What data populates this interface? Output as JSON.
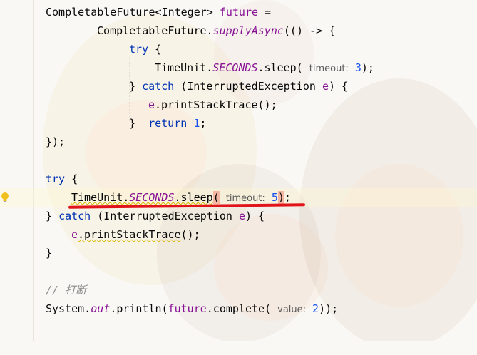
{
  "editor": {
    "lines": {
      "l1": {
        "a": "CompletableFuture",
        "b": "<Integer> ",
        "c": "future",
        "d": " ="
      },
      "l2": {
        "a": "CompletableFuture.",
        "b": "supplyAsync",
        "c": "(() -> {"
      },
      "l3": {
        "a": "try",
        "b": " {"
      },
      "l4": {
        "a": "TimeUnit.",
        "b": "SECONDS",
        "c": ".sleep(",
        "hint": "timeout:",
        "d": "3",
        "e": ");"
      },
      "l5": {
        "a": "} ",
        "b": "catch",
        "c": " (InterruptedException ",
        "d": "e",
        "e": ") {"
      },
      "l6": {
        "a": "e",
        "b": ".printStackTrace();"
      },
      "l7": {
        "a": "}  ",
        "b": "return",
        "c": " ",
        "d": "1",
        "e": ";"
      },
      "l8": {
        "a": "});"
      },
      "l10": {
        "a": "try",
        "b": " {"
      },
      "l11": {
        "a": "TimeUnit.",
        "b": "SECONDS",
        "c": ".sleep",
        "d": "(",
        "hint": "timeout:",
        "e": "5",
        "f": ")",
        "g": ";"
      },
      "l12": {
        "a": "} ",
        "b": "catch",
        "c": " (InterruptedException ",
        "d": "e",
        "e": ") {"
      },
      "l13": {
        "a": "e",
        "b": ".printStackTrace",
        "c": "();"
      },
      "l14": {
        "a": "}"
      },
      "l16": {
        "a": "// 打断"
      },
      "l17": {
        "a": "System.",
        "b": "out",
        "c": ".println(",
        "d": "future",
        "e": ".complete(",
        "hint": "value:",
        "f": "2",
        "g": "));"
      }
    }
  },
  "colors": {
    "keyword": "#0033b3",
    "field": "#871094",
    "number": "#1750eb",
    "annotation_red": "#e0141a",
    "bracket_highlight": "#f5b5a0"
  },
  "icons": {
    "gutter": "lightbulb-icon"
  }
}
